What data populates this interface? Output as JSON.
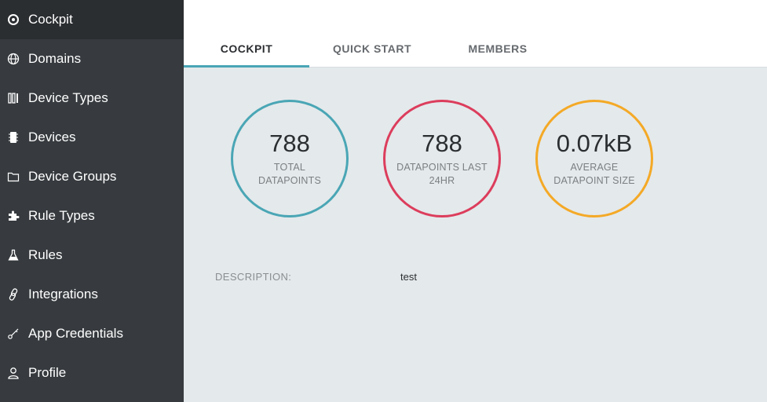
{
  "sidebar": {
    "items": [
      {
        "label": "Cockpit",
        "icon": "compass-icon",
        "active": true
      },
      {
        "label": "Domains",
        "icon": "globe-icon"
      },
      {
        "label": "Device Types",
        "icon": "device-types-icon"
      },
      {
        "label": "Devices",
        "icon": "chip-icon"
      },
      {
        "label": "Device Groups",
        "icon": "folder-icon"
      },
      {
        "label": "Rule Types",
        "icon": "puzzle-icon"
      },
      {
        "label": "Rules",
        "icon": "flask-icon"
      },
      {
        "label": "Integrations",
        "icon": "link-icon"
      },
      {
        "label": "App Credentials",
        "icon": "key-icon"
      },
      {
        "label": "Profile",
        "icon": "user-icon"
      }
    ]
  },
  "tabs": [
    {
      "label": "COCKPIT",
      "active": true
    },
    {
      "label": "QUICK START"
    },
    {
      "label": "MEMBERS"
    }
  ],
  "stats": [
    {
      "value": "788",
      "label": "TOTAL DATAPOINTS",
      "color": "#4aa6b5"
    },
    {
      "value": "788",
      "label": "DATAPOINTS LAST 24HR",
      "color": "#dc3d5c"
    },
    {
      "value": "0.07kB",
      "label": "AVERAGE DATAPOINT SIZE",
      "color": "#f4a926"
    }
  ],
  "description": {
    "label": "DESCRIPTION:",
    "value": "test"
  },
  "colors": {
    "sidebar_bg": "#373b3f",
    "sidebar_active": "#2b2e31",
    "content_bg": "#e4e9eb",
    "tab_accent": "#4aa6b5"
  }
}
